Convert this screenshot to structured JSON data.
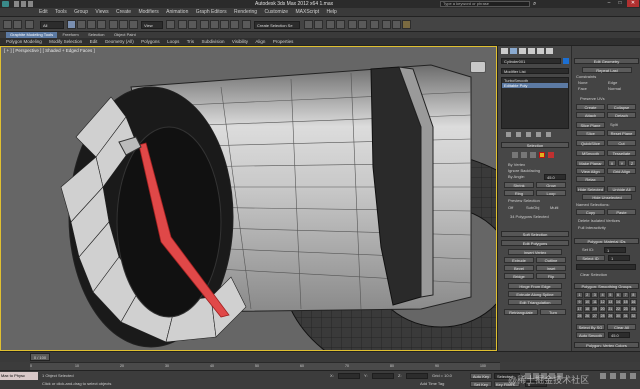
{
  "title_bar": {
    "title": "Autodesk 3ds Max 2012 x64    1.max",
    "search_placeholder": "Type a keyword or phrase"
  },
  "menu": [
    "Edit",
    "Tools",
    "Group",
    "Views",
    "Create",
    "Modifiers",
    "Animation",
    "Graph Editors",
    "Rendering",
    "Customize",
    "MAXScript",
    "Help"
  ],
  "toolbar": {
    "filter": "All",
    "view_dropdown": "View",
    "selection_set": "Create Selection Se"
  },
  "ribbon_tabs": [
    "Graphite Modeling Tools",
    "Freeform",
    "Selection",
    "Object Paint"
  ],
  "ribbon_items": [
    "Polygon Modeling",
    "Modify Selection",
    "Edit",
    "Geometry (All)",
    "Polygons",
    "Loops",
    "Tris",
    "Subdivision",
    "Visibility",
    "Align",
    "Properties"
  ],
  "viewport": {
    "label": "[ + ] [ Perspective ] [ Shaded + Edged Faces ]"
  },
  "command_panel": {
    "object_name": "Cylinder001",
    "modifier_list": "Modifier List",
    "stack": [
      "TurboSmooth",
      "Editable Poly"
    ],
    "selection": {
      "title": "Selection",
      "by_vertex": "By Vertex",
      "ignore_backfacing": "Ignore Backfacing",
      "by_angle": "By Angle:",
      "by_angle_value": "45.0",
      "shrink": "Shrink",
      "grow": "Grow",
      "ring": "Ring",
      "loop": "Loop",
      "preview": "Preview Selection",
      "off": "Off",
      "subobj": "SubObj",
      "multi": "Multi",
      "status": "34 Polygons Selected"
    },
    "soft_selection": "Soft Selection",
    "edit_polygons": {
      "title": "Edit Polygons",
      "insert_vertex": "Insert Vertex",
      "buttons": [
        "Extrude",
        "Outline",
        "Bevel",
        "Inset",
        "Bridge",
        "Flip"
      ],
      "hinge": "Hinge From Edge",
      "extrude_spline": "Extrude Along Spline",
      "edit_tri": "Edit Triangulation",
      "retriangulate": "Retriangulate",
      "turn": "Turn"
    },
    "edit_geometry": {
      "title": "Edit Geometry",
      "repeat_last": "Repeat Last",
      "constraints": "Constraints",
      "none": "None",
      "edge": "Edge",
      "face": "Face",
      "normal": "Normal",
      "preserve_uvs": "Preserve UVs",
      "create": "Create",
      "collapse": "Collapse",
      "attach": "Attach",
      "detach": "Detach",
      "slice_plane": "Slice Plane",
      "split": "Split",
      "slice": "Slice",
      "reset_plane": "Reset Plane",
      "quickslice": "QuickSlice",
      "cut": "Cut",
      "msmooth": "MSmooth",
      "tessellate": "Tessellate",
      "make_planar": "Make Planar",
      "xyz": [
        "X",
        "Y",
        "Z"
      ],
      "view_align": "View Align",
      "grid_align": "Grid Align",
      "relax": "Relax",
      "hide_selected": "Hide Selected",
      "unhide_all": "Unhide All",
      "hide_unselected": "Hide Unselected",
      "named_selections": "Named Selections:",
      "copy": "Copy",
      "paste": "Paste",
      "delete_isolated": "Delete Isolated Vertices",
      "full_interactivity": "Full Interactivity"
    },
    "material_ids": {
      "title": "Polygon: Material IDs",
      "set_id": "Set ID:",
      "set_id_value": "1",
      "select_id": "Select ID",
      "select_id_value": "1",
      "clear_selection": "Clear Selection"
    },
    "smoothing": {
      "title": "Polygon: Smoothing Groups",
      "numbers": [
        "1",
        "2",
        "3",
        "4",
        "5",
        "6",
        "7",
        "8",
        "9",
        "10",
        "11",
        "12",
        "13",
        "14",
        "15",
        "16",
        "17",
        "18",
        "19",
        "20",
        "21",
        "22",
        "23",
        "24",
        "25",
        "26",
        "27",
        "28",
        "29",
        "30",
        "31",
        "32"
      ],
      "select_by_sg": "Select By SG",
      "clear_all": "Clear All",
      "auto_smooth": "Auto Smooth",
      "auto_smooth_value": "45.0"
    },
    "vertex_colors": "Polygon: Vertex Colors"
  },
  "timeline": {
    "frame": "0 / 100",
    "ticks": [
      "0",
      "10",
      "20",
      "30",
      "40",
      "50",
      "60",
      "70",
      "80",
      "90",
      "100"
    ]
  },
  "status_bar": {
    "listener": "Max to Physc",
    "objects_selected": "1 Object Selected",
    "prompt": "Click or click-and-drag to select objects",
    "x": "X:",
    "y": "Y:",
    "z": "Z:",
    "grid": "Grid = 10.0",
    "auto_key": "Auto Key",
    "selected": "Selected",
    "set_key": "Set Key",
    "key_filters": "Key Filters...",
    "add_time_tag": "Add Time Tag",
    "frame_value": "0"
  },
  "watermark": "@稀土掘金技术社区",
  "colors": {
    "viewport_bg": "#666666",
    "selection_red": "#e04848",
    "active_border": "#e0c030",
    "accent_blue": "#5c7aa3"
  }
}
